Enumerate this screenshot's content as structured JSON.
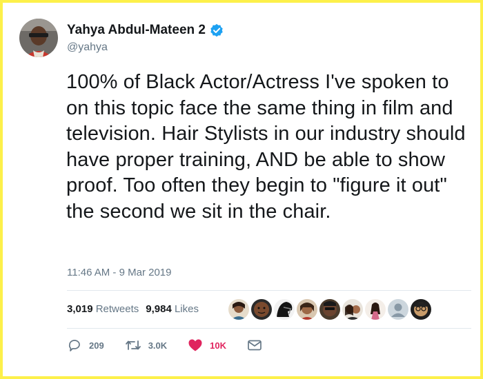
{
  "author": {
    "display_name": "Yahya Abdul-Mateen 2",
    "handle": "@yahya",
    "verified": true,
    "avatar_icon": "profile-photo"
  },
  "tweet": {
    "text": "100% of Black Actor/Actress I've spoken to on this topic face the same thing in film and television. Hair Stylists in our industry should have proper training, AND be able to show proof. Too often they begin to \"figure it out\" the second we sit in the chair.",
    "timestamp": "11:46 AM - 9 Mar 2019"
  },
  "stats": {
    "retweets_count": "3,019",
    "retweets_label": "Retweets",
    "likes_count": "9,984",
    "likes_label": "Likes",
    "liker_avatar_icons": [
      "profile-photo",
      "profile-photo",
      "profile-photo",
      "profile-photo",
      "profile-photo",
      "profile-photo",
      "profile-photo",
      "default-avatar",
      "profile-photo"
    ]
  },
  "actions": {
    "reply_count": "209",
    "retweet_count": "3.0K",
    "like_count": "10K"
  },
  "colors": {
    "frame_border": "#fdf04a",
    "verified_badge": "#1da1f2",
    "secondary_text": "#657786",
    "like_active": "#e0245e"
  }
}
